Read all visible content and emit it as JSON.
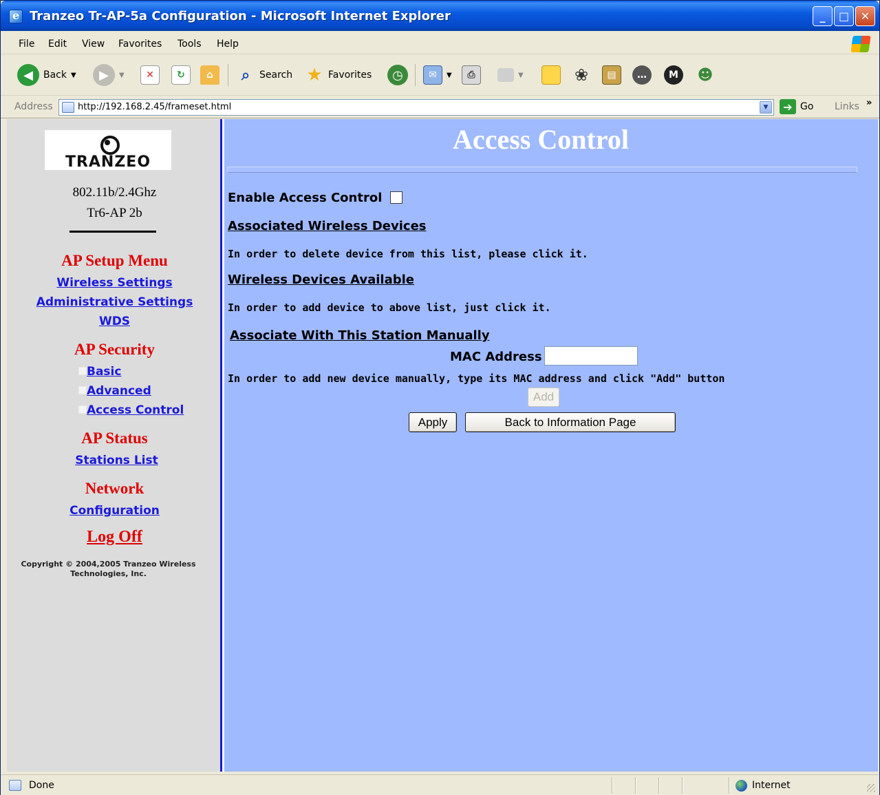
{
  "window": {
    "title": "Tranzeo Tr-AP-5a Configuration - Microsoft Internet Explorer",
    "minimize_glyph": "_",
    "maximize_glyph": "□",
    "close_glyph": "✕"
  },
  "menubar": {
    "items": [
      "File",
      "Edit",
      "View",
      "Favorites",
      "Tools",
      "Help"
    ]
  },
  "toolbar": {
    "back_label": "Back",
    "search_label": "Search",
    "favorites_label": "Favorites"
  },
  "addressbar": {
    "label": "Address",
    "url": "http://192.168.2.45/frameset.html",
    "go_label": "Go",
    "links_label": "Links",
    "chevron": "»"
  },
  "sidebar": {
    "logo_text": "TRANZEO",
    "model_line1": "802.11b/2.4Ghz",
    "model_line2": "Tr6-AP 2b",
    "setup_heading": "AP Setup Menu",
    "wireless_settings": "Wireless Settings",
    "administrative_settings": "Administrative Settings",
    "wds": "WDS",
    "security_heading": "AP Security",
    "basic": "Basic",
    "advanced": "Advanced",
    "access_control": "Access Control",
    "status_heading": "AP Status",
    "stations_list": "Stations List",
    "network_heading": "Network",
    "configuration": "Configuration",
    "log_off": "Log Off",
    "copyright_line1": "Copyright © 2004,2005 Tranzeo Wireless",
    "copyright_line2": "Technologies, Inc."
  },
  "main": {
    "title": "Access Control",
    "enable_label": "Enable Access Control",
    "enable_checked": false,
    "associated_link": "Associated Wireless Devices",
    "delete_hint": "In order to delete device from this list, please click it.",
    "available_link": "Wireless Devices Available",
    "add_hint": "In order to add device to above list, just click it.",
    "manual_link": "Associate With This Station Manually",
    "mac_label": "MAC Address",
    "mac_value": "",
    "manual_hint": "In order to add new device manually, type its MAC address and click \"Add\" button",
    "add_button": "Add",
    "apply_button": "Apply",
    "back_button": "Back to Information Page"
  },
  "statusbar": {
    "status": "Done",
    "zone": "Internet"
  },
  "colors": {
    "title_bar": "#0a5ae0",
    "sidebar_bg": "#dcdcdc",
    "main_bg": "#a0baff",
    "heading_red": "#e00000",
    "link_blue": "#1a1adc",
    "divider_blue": "#1a1adc"
  }
}
